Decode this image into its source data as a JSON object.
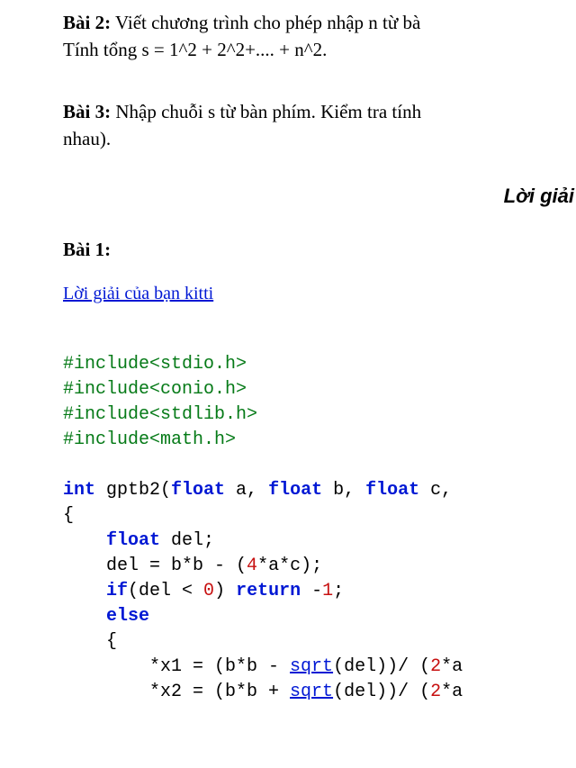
{
  "exercise2": {
    "title": "Bài 2:",
    "line1": " Viết chương trình cho phép nhập n từ bà",
    "line2": "Tính tổng s = 1^2 + 2^2+.... + n^2."
  },
  "exercise3": {
    "title": "Bài 3:",
    "line1": " Nhập chuỗi s từ bàn phím. Kiểm tra tính",
    "line2": "nhau)."
  },
  "answer_heading": "Lời giải",
  "solution": {
    "title": "Bài 1:",
    "link_text": "Lời giải của bạn kitti"
  },
  "code": {
    "inc1": "#include<stdio.h>",
    "inc2": "#include<conio.h>",
    "inc3": "#include<stdlib.h>",
    "inc4": "#include<math.h>",
    "kw_int": "int",
    "fn_name": " gptb2(",
    "kw_float": "float",
    "a_decl": " a, ",
    "b_decl": " b, ",
    "c_decl": " c,",
    "brace_open": "{",
    "indent1": "    ",
    "del_decl": " del;",
    "del_assign_left": "    del = b*b - (",
    "four": "4",
    "del_assign_right": "*a*c);",
    "if_kw": "if",
    "if_cond_left": "(del < ",
    "zero": "0",
    "if_cond_right": ") ",
    "return_kw": "return",
    "return_val": " -",
    "one": "1",
    "semicolon": ";",
    "else_kw": "else",
    "inner_brace": "    {",
    "x1_left": "        *x1 = (b*b - ",
    "sqrt": "sqrt",
    "x1_mid": "(del))/ (",
    "two_a": "2",
    "x1_right": "*a",
    "x2_left": "        *x2 = (b*b + ",
    "x2_right": "*a"
  }
}
